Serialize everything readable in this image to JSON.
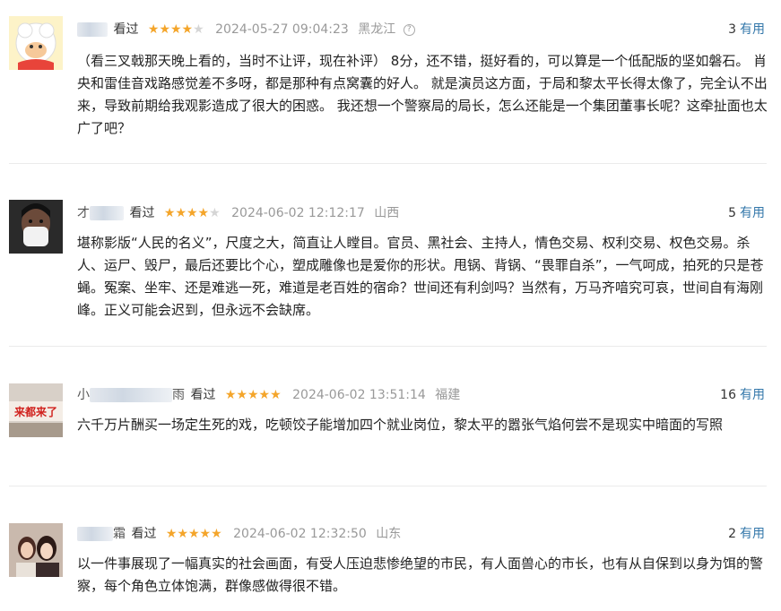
{
  "reviews": [
    {
      "name_prefix": "",
      "name_suffix": "",
      "watched": "看过",
      "stars": 4,
      "time": "2024-05-27 09:04:23",
      "location": "黑龙江",
      "useful_count": "3",
      "useful_label": "有用",
      "avatar": "sheep-avatar",
      "content": "（看三叉戟那天晚上看的，当时不让评，现在补评） 8分，还不错，挺好看的，可以算是一个低配版的坚如磐石。 肖央和雷佳音戏路感觉差不多呀，都是那种有点窝囊的好人。 就是演员这方面，于局和黎太平长得太像了，完全认不出来，导致前期给我观影造成了很大的困惑。 我还想一个警察局的局长，怎么还能是一个集团董事长呢？这牵扯面也太广了吧？"
    },
    {
      "name_prefix": "",
      "name_suffix": "",
      "watched": "看过",
      "stars": 4,
      "time": "2024-06-02 12:12:17",
      "location": "山西",
      "useful_count": "5",
      "useful_label": "有用",
      "avatar": "masked-man-avatar",
      "content": "堪称影版“人民的名义”，尺度之大，简直让人瞠目。官员、黑社会、主持人，情色交易、权利交易、权色交易。杀人、运尸、毁尸，最后还要比个心，塑成雕像也是爱你的形状。甩锅、背锅、“畏罪自杀”，一气呵成，拍死的只是苍蝇。冤案、坐牢、还是难逃一死，难道是老百姓的宿命？世间还有利剑吗？当然有，万马齐喑究可哀，世间自有海刚峰。正义可能会迟到，但永远不会缺席。"
    },
    {
      "name_prefix": "小",
      "name_suffix": "雨",
      "watched": "看过",
      "stars": 5,
      "time": "2024-06-02 13:51:14",
      "location": "福建",
      "useful_count": "16",
      "useful_label": "有用",
      "avatar": "banner-avatar",
      "avatar_text": "来都来了",
      "content": "六千万片酬买一场定生死的戏，吃顿饺子能增加四个就业岗位，黎太平的嚣张气焰何尝不是现实中暗面的写照"
    },
    {
      "name_prefix": "",
      "name_suffix": "霜",
      "watched": "看过",
      "stars": 5,
      "time": "2024-06-02 12:32:50",
      "location": "山东",
      "useful_count": "2",
      "useful_label": "有用",
      "avatar": "two-women-avatar",
      "content": "以一件事展现了一幅真实的社会画面，有受人压迫悲惨绝望的市民，有人面兽心的市长，也有从自保到以身为饵的警察，每个角色立体饱满，群像感做得很不错。"
    }
  ],
  "colors": {
    "star": "#f4a52a",
    "link": "#3377aa",
    "meta_gray": "#999999"
  }
}
